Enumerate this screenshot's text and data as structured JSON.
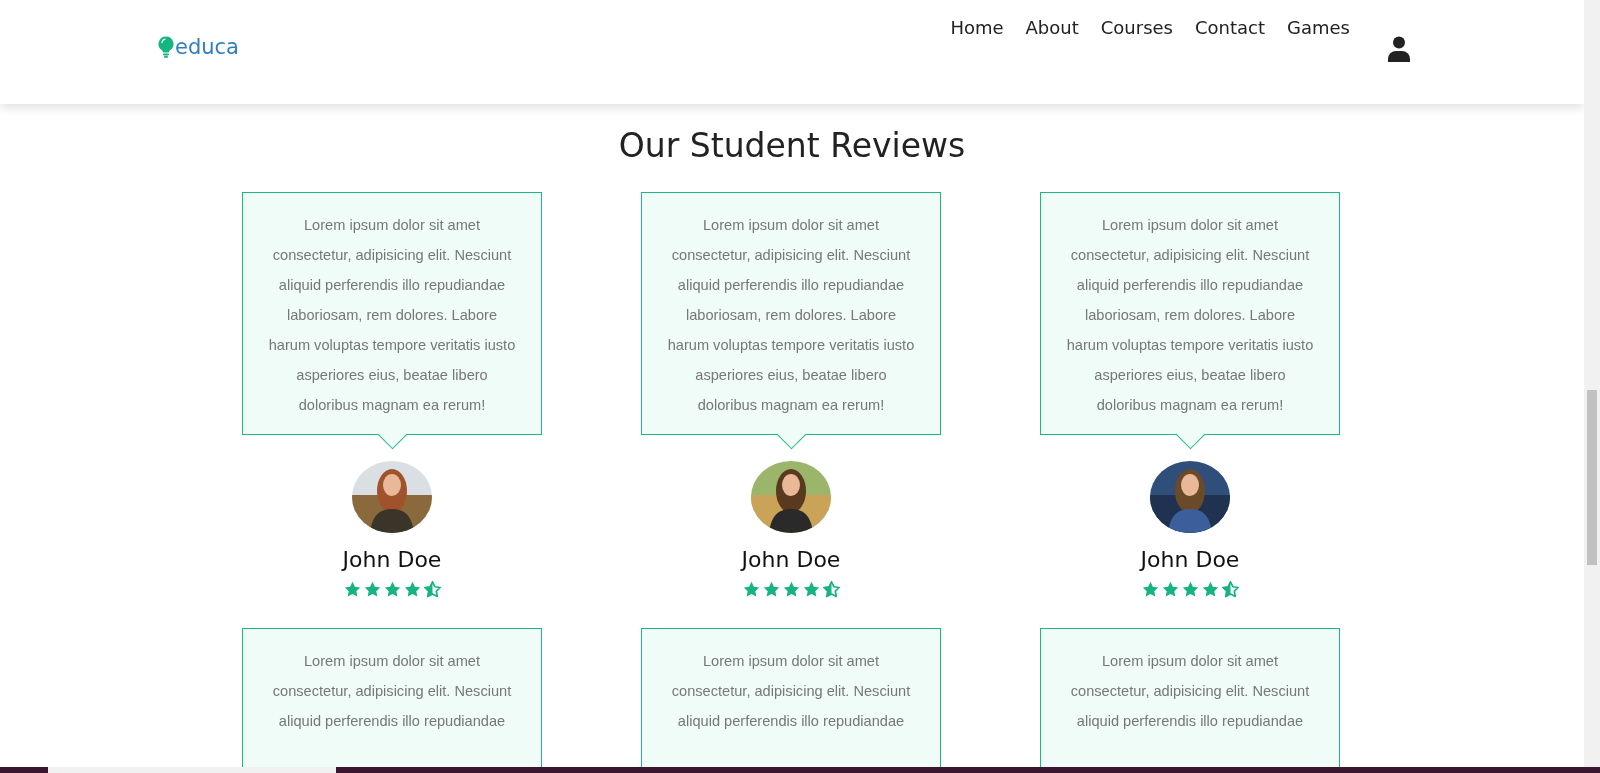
{
  "header": {
    "logo": "educa",
    "nav": [
      "Home",
      "About",
      "Courses",
      "Contact",
      "Games"
    ]
  },
  "title": "Our Student Reviews",
  "reviews": [
    {
      "text": "Lorem ipsum dolor sit amet consectetur, adipisicing elit. Nesciunt aliquid perferendis illo repudiandae laboriosam, rem dolores. Labore harum voluptas tempore veritatis iusto asperiores eius, beatae libero doloribus magnam ea rerum!",
      "name": "John Doe",
      "stars": 4.5
    },
    {
      "text": "Lorem ipsum dolor sit amet consectetur, adipisicing elit. Nesciunt aliquid perferendis illo repudiandae laboriosam, rem dolores. Labore harum voluptas tempore veritatis iusto asperiores eius, beatae libero doloribus magnam ea rerum!",
      "name": "John Doe",
      "stars": 4.5
    },
    {
      "text": "Lorem ipsum dolor sit amet consectetur, adipisicing elit. Nesciunt aliquid perferendis illo repudiandae laboriosam, rem dolores. Labore harum voluptas tempore veritatis iusto asperiores eius, beatae libero doloribus magnam ea rerum!",
      "name": "John Doe",
      "stars": 4.5
    }
  ],
  "more_reviews": [
    {
      "text": "Lorem ipsum dolor sit amet consectetur, adipisicing elit. Nesciunt aliquid perferendis illo repudiandae"
    },
    {
      "text": "Lorem ipsum dolor sit amet consectetur, adipisicing elit. Nesciunt aliquid perferendis illo repudiandae"
    },
    {
      "text": "Lorem ipsum dolor sit amet consectetur, adipisicing elit. Nesciunt aliquid perferendis illo repudiandae"
    }
  ]
}
